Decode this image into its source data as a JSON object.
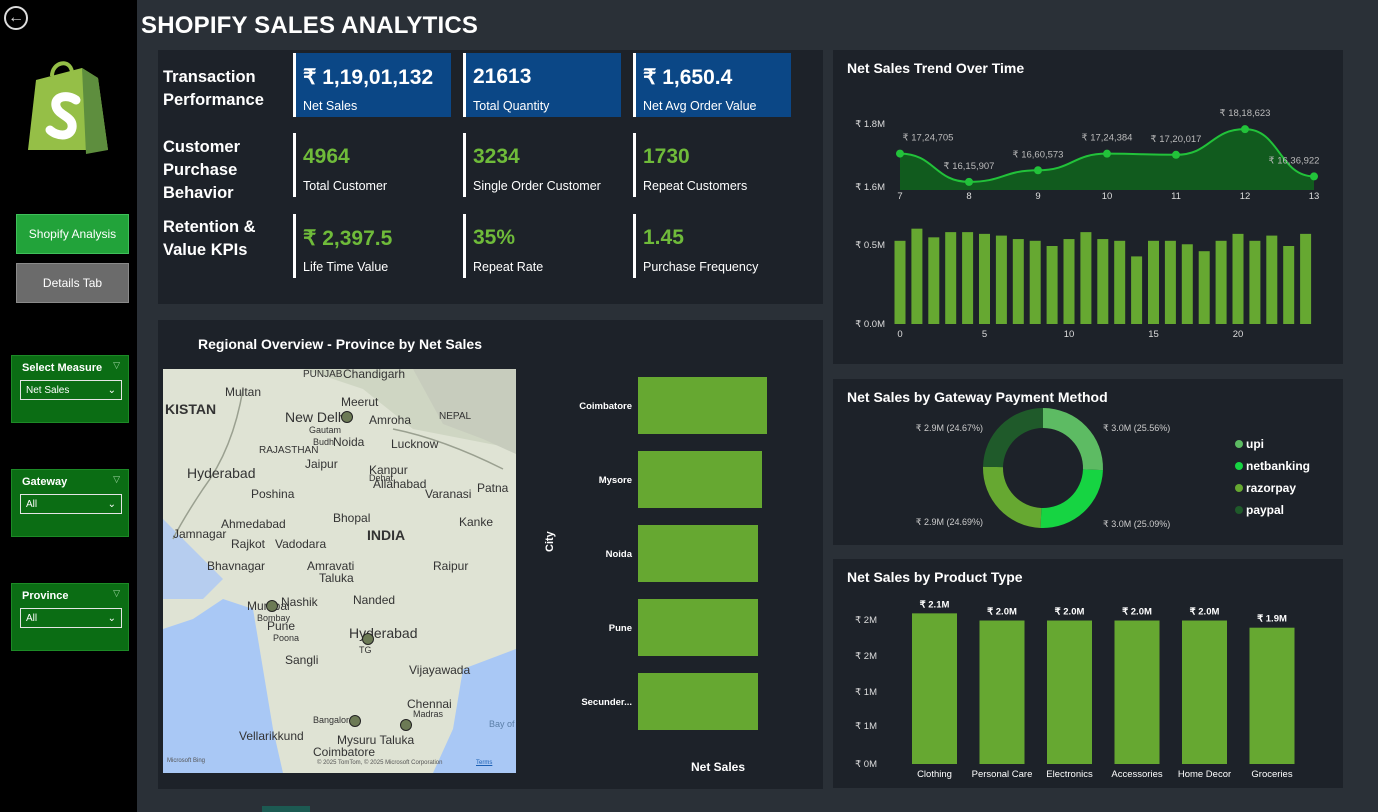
{
  "title": "SHOPIFY SALES ANALYTICS",
  "nav": {
    "back_icon": "arrow-left-circle-icon",
    "active_tab": "Shopify Analysis",
    "inactive_tab": "Details Tab"
  },
  "filters": [
    {
      "label": "Select Measure",
      "value": "Net Sales"
    },
    {
      "label": "Gateway",
      "value": "All"
    },
    {
      "label": "Province",
      "value": "All"
    }
  ],
  "kpi_rows": {
    "transaction": "Transaction Performance",
    "customer": "Customer Purchase Behavior",
    "retention": "Retention & Value KPIs"
  },
  "kpis": {
    "net_sales": {
      "value": "₹ 1,19,01,132",
      "label": "Net Sales"
    },
    "total_quantity": {
      "value": "21613",
      "label": "Total Quantity"
    },
    "avg_order": {
      "value": "₹ 1,650.4",
      "label": "Net Avg Order Value"
    },
    "total_customer": {
      "value": "4964",
      "label": "Total Customer"
    },
    "single_order": {
      "value": "3234",
      "label": "Single Order Customer"
    },
    "repeat_customers": {
      "value": "1730",
      "label": "Repeat Customers"
    },
    "ltv": {
      "value": "₹ 2,397.5",
      "label": "Life Time Value"
    },
    "repeat_rate": {
      "value": "35%",
      "label": "Repeat Rate"
    },
    "purchase_freq": {
      "value": "1.45",
      "label": "Purchase Frequency"
    }
  },
  "region": {
    "title": "Regional Overview - Province by Net Sales",
    "axis_city": "City",
    "axis_net_sales": "Net Sales",
    "map_labels": [
      "PUNJAB",
      "Chandigarh",
      "KISTAN",
      "Multan",
      "New Delhi",
      "Meerut",
      "NEPAL",
      "Amroha",
      "Gautam",
      "Budh",
      "Noida",
      "Lucknow",
      "RAJASTHAN",
      "Hyderabad",
      "Jaipur",
      "Kanpur",
      "Dehat",
      "Allahabad",
      "Patna",
      "Poshina",
      "Varanasi",
      "Jamnagar",
      "Ahmedabad",
      "Bhopal",
      "INDIA",
      "Kanke",
      "Rajkot",
      "Vadodara",
      "Bhavnagar",
      "Amravati",
      "Taluka",
      "Raipur",
      "Mumbai",
      "Bombay",
      "Nashik",
      "Nanded",
      "Pune",
      "Poona",
      "Hyderabad",
      "TG",
      "Sangli",
      "Vijayawada",
      "Chennai",
      "Madras",
      "Bangalore",
      "Mysuru Taluka",
      "Vellarikkund",
      "Coimbatore",
      "Bay of Ben"
    ],
    "map_credit": "© 2025 TomTom, © 2025 Microsoft Corporation",
    "map_terms": "Terms",
    "map_brand": "Microsoft Bing",
    "cities": [
      "Coimbatore",
      "Mysore",
      "Noida",
      "Pune",
      "Secunder..."
    ]
  },
  "trend_title": "Net Sales Trend Over Time",
  "gateway_title": "Net Sales by Gateway Payment Method",
  "product_title": "Net Sales by Product Type",
  "colors": {
    "green": "#66a831",
    "kpi_blue": "#0b4786",
    "kpi_green_text": "#6fbb3a",
    "active_nav": "#22a33a",
    "filter_bg": "#0b6d14"
  },
  "chart_data": [
    {
      "type": "area",
      "title": "Net Sales Trend Over Time",
      "x": [
        7,
        8,
        9,
        10,
        11,
        12,
        13
      ],
      "values": [
        1724705,
        1615907,
        1660573,
        1724384,
        1720017,
        1818623,
        1636922
      ],
      "labels": [
        "₹ 17,24,705",
        "₹ 16,15,907",
        "₹ 16,60,573",
        "₹ 17,24,384",
        "₹ 17,20,017",
        "₹ 18,18,623",
        "₹ 16,36,922"
      ],
      "y_ticks": [
        "₹ 1.8M",
        "₹ 1.6M"
      ],
      "ylim": [
        1600000,
        1800000
      ],
      "grid": false
    },
    {
      "type": "bar",
      "x": [
        0,
        1,
        2,
        3,
        4,
        5,
        6,
        7,
        8,
        9,
        10,
        11,
        12,
        13,
        14,
        15,
        16,
        17,
        18,
        19,
        20,
        21,
        22,
        23
      ],
      "values": [
        480000,
        550000,
        500000,
        530000,
        530000,
        520000,
        510000,
        490000,
        480000,
        450000,
        490000,
        530000,
        490000,
        480000,
        390000,
        480000,
        480000,
        460000,
        420000,
        480000,
        520000,
        480000,
        510000,
        450000,
        520000
      ],
      "x_ticks": [
        "0",
        "5",
        "10",
        "15",
        "20"
      ],
      "y_ticks": [
        "₹ 0.5M",
        "₹ 0.0M"
      ],
      "ylim": [
        0,
        600000
      ]
    },
    {
      "type": "pie",
      "title": "Net Sales by Gateway Payment Method",
      "categories": [
        "upi",
        "netbanking",
        "razorpay",
        "paypal"
      ],
      "values": [
        25.56,
        25.09,
        24.69,
        24.67
      ],
      "labels": [
        "₹ 3.0M (25.56%)",
        "₹ 3.0M (25.09%)",
        "₹ 2.9M (24.69%)",
        "₹ 2.9M (24.67%)"
      ],
      "colors": [
        "#5dbb63",
        "#16d442",
        "#66a831",
        "#1f5a2a"
      ],
      "legend": "right"
    },
    {
      "type": "bar",
      "title": "Net Sales by Product Type",
      "categories": [
        "Clothing",
        "Personal Care",
        "Electronics",
        "Accessories",
        "Home Decor",
        "Groceries"
      ],
      "values": [
        2100000,
        2000000,
        2000000,
        2000000,
        2000000,
        1900000
      ],
      "labels": [
        "₹ 2.1M",
        "₹ 2.0M",
        "₹ 2.0M",
        "₹ 2.0M",
        "₹ 2.0M",
        "₹ 1.9M"
      ],
      "y_ticks": [
        "₹ 2M",
        "₹ 2M",
        "₹ 1M",
        "₹ 1M",
        "₹ 0M"
      ],
      "ylim": [
        0,
        2300000
      ]
    },
    {
      "type": "bar",
      "title": "Regional Overview - Province by Net Sales",
      "categories": [
        "Coimbatore",
        "Mysore",
        "Noida",
        "Pune",
        "Secunder..."
      ],
      "values": [
        100,
        96,
        93,
        93,
        93
      ],
      "xlabel": "Net Sales",
      "ylabel": "City"
    }
  ]
}
